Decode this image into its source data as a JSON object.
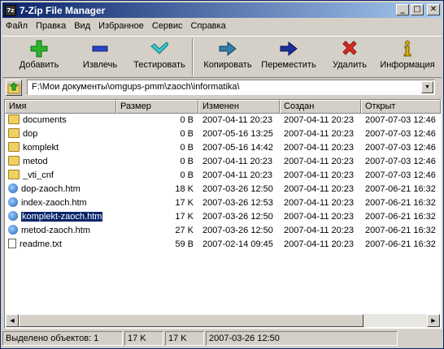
{
  "window": {
    "title": "7-Zip File Manager",
    "icon_label": "7z",
    "buttons": [
      "minimize-icon",
      "maximize-icon",
      "close-icon"
    ]
  },
  "menu": [
    "Файл",
    "Правка",
    "Вид",
    "Избранное",
    "Сервис",
    "Справка"
  ],
  "toolbar": {
    "add": "Добавить",
    "extract": "Извлечь",
    "test": "Тестировать",
    "copy": "Копировать",
    "move": "Переместить",
    "delete": "Удалить",
    "info": "Информация"
  },
  "address": {
    "path": "F:\\Мои документы\\omgups-pmm\\zaoch\\informatika\\"
  },
  "columns": [
    "Имя",
    "Размер",
    "Изменен",
    "Создан",
    "Открыт"
  ],
  "files": [
    {
      "name": "documents",
      "type": "folder",
      "size": "0 B",
      "modified": "2007-04-11 20:23",
      "created": "2007-04-11 20:23",
      "opened": "2007-07-03 12:46"
    },
    {
      "name": "dop",
      "type": "folder",
      "size": "0 B",
      "modified": "2007-05-16 13:25",
      "created": "2007-04-11 20:23",
      "opened": "2007-07-03 12:46"
    },
    {
      "name": "komplekt",
      "type": "folder",
      "size": "0 B",
      "modified": "2007-05-16 14:42",
      "created": "2007-04-11 20:23",
      "opened": "2007-07-03 12:46"
    },
    {
      "name": "metod",
      "type": "folder",
      "size": "0 B",
      "modified": "2007-04-11 20:23",
      "created": "2007-04-11 20:23",
      "opened": "2007-07-03 12:46"
    },
    {
      "name": "_vti_cnf",
      "type": "folder",
      "size": "0 B",
      "modified": "2007-04-11 20:23",
      "created": "2007-04-11 20:23",
      "opened": "2007-07-03 12:46"
    },
    {
      "name": "dop-zaoch.htm",
      "type": "htm",
      "size": "18 K",
      "modified": "2007-03-26 12:50",
      "created": "2007-04-11 20:23",
      "opened": "2007-06-21 16:32"
    },
    {
      "name": "index-zaoch.htm",
      "type": "htm",
      "size": "17 K",
      "modified": "2007-03-26 12:53",
      "created": "2007-04-11 20:23",
      "opened": "2007-06-21 16:32"
    },
    {
      "name": "komplekt-zaoch.htm",
      "type": "htm",
      "size": "17 K",
      "modified": "2007-03-26 12:50",
      "created": "2007-04-11 20:23",
      "opened": "2007-06-21 16:32",
      "selected": true
    },
    {
      "name": "metod-zaoch.htm",
      "type": "htm",
      "size": "27 K",
      "modified": "2007-03-26 12:50",
      "created": "2007-04-11 20:23",
      "opened": "2007-06-21 16:32"
    },
    {
      "name": "readme.txt",
      "type": "txt",
      "size": "59 B",
      "modified": "2007-02-14 09:45",
      "created": "2007-04-11 20:23",
      "opened": "2007-06-21 16:32"
    }
  ],
  "status": {
    "selected": "Выделено объектов: 1",
    "size1": "17 K",
    "size2": "17 K",
    "date": "2007-03-26 12:50"
  },
  "colors": {
    "title_start": "#0a246a",
    "title_end": "#a6caf0",
    "selection": "#0a246a"
  }
}
